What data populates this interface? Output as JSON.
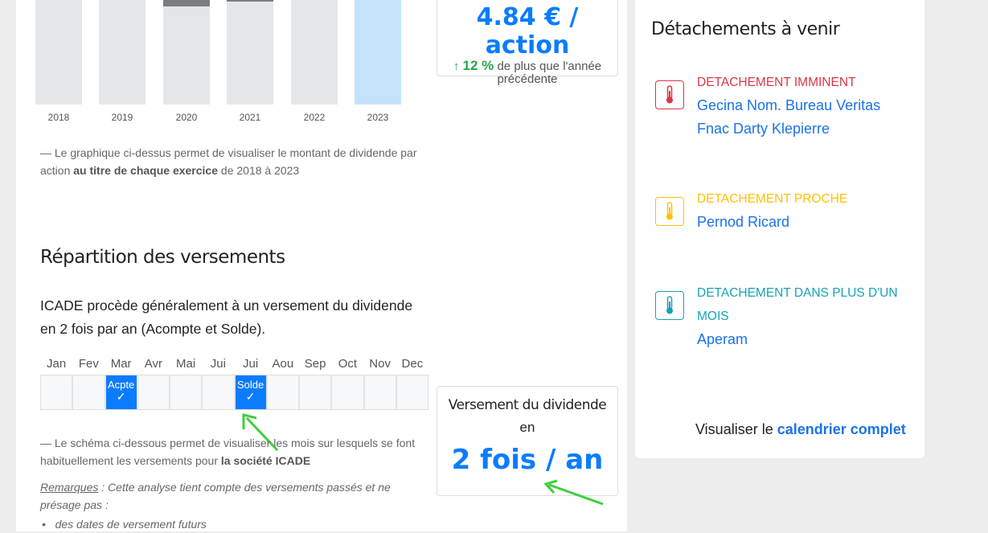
{
  "chart_data": {
    "type": "bar",
    "categories": [
      "2018",
      "2019",
      "2020",
      "2021",
      "2022",
      "2023"
    ],
    "highlight": "2023",
    "title": "",
    "xlabel": "",
    "ylabel": ""
  },
  "chart_caption": {
    "prefix": "— Le graphique ci-dessus permet de visualiser le montant de dividende par action ",
    "bold": "au titre de chaque exercice",
    "suffix": " de 2018 à 2023"
  },
  "summary": {
    "amount": "4.84 € / action",
    "arrow": "↑",
    "change": "12 %",
    "change_text": " de plus que l'année précédente"
  },
  "repartition": {
    "title": "Répartition des versements",
    "intro": "ICADE procède généralement à un versement du dividende en 2 fois par an (Acompte et Solde).",
    "months": [
      "Jan",
      "Fev",
      "Mar",
      "Avr",
      "Mai",
      "Jui",
      "Jui",
      "Aou",
      "Sep",
      "Oct",
      "Nov",
      "Dec"
    ],
    "payments": [
      {
        "month_index": 2,
        "label": "Acpte"
      },
      {
        "month_index": 6,
        "label": "Solde"
      }
    ],
    "check": "✓",
    "caption": {
      "prefix": "—  Le schéma ci-dessous permet de visualiser les mois sur lesquels se font habituellement les versements pour ",
      "bold": "la société ICADE"
    },
    "remarks_label": "Remarques",
    "remarks_text": " : Cette analyse tient compte des versements passés et ne présage pas :",
    "remarks_items": [
      "des dates de versement futurs"
    ]
  },
  "frequency": {
    "label": "Versement du dividende",
    "label2": "en",
    "value": "2 fois / an"
  },
  "detachements": {
    "title": "Détachements à venir",
    "groups": [
      {
        "category": "DETACHEMENT IMMINENT",
        "color": "#dc3545",
        "companies": [
          "Gecina Nom. Bureau Veritas",
          "Fnac Darty Klepierre"
        ]
      },
      {
        "category": "DETACHEMENT PROCHE",
        "color": "#ffc107",
        "companies": [
          "Pernod Ricard"
        ]
      },
      {
        "category": "DETACHEMENT DANS PLUS D'UN MOIS",
        "color": "#17a2b8",
        "companies": [
          "Aperam"
        ]
      }
    ],
    "footer_prefix": "Visualiser le ",
    "footer_link": "calendrier complet"
  }
}
